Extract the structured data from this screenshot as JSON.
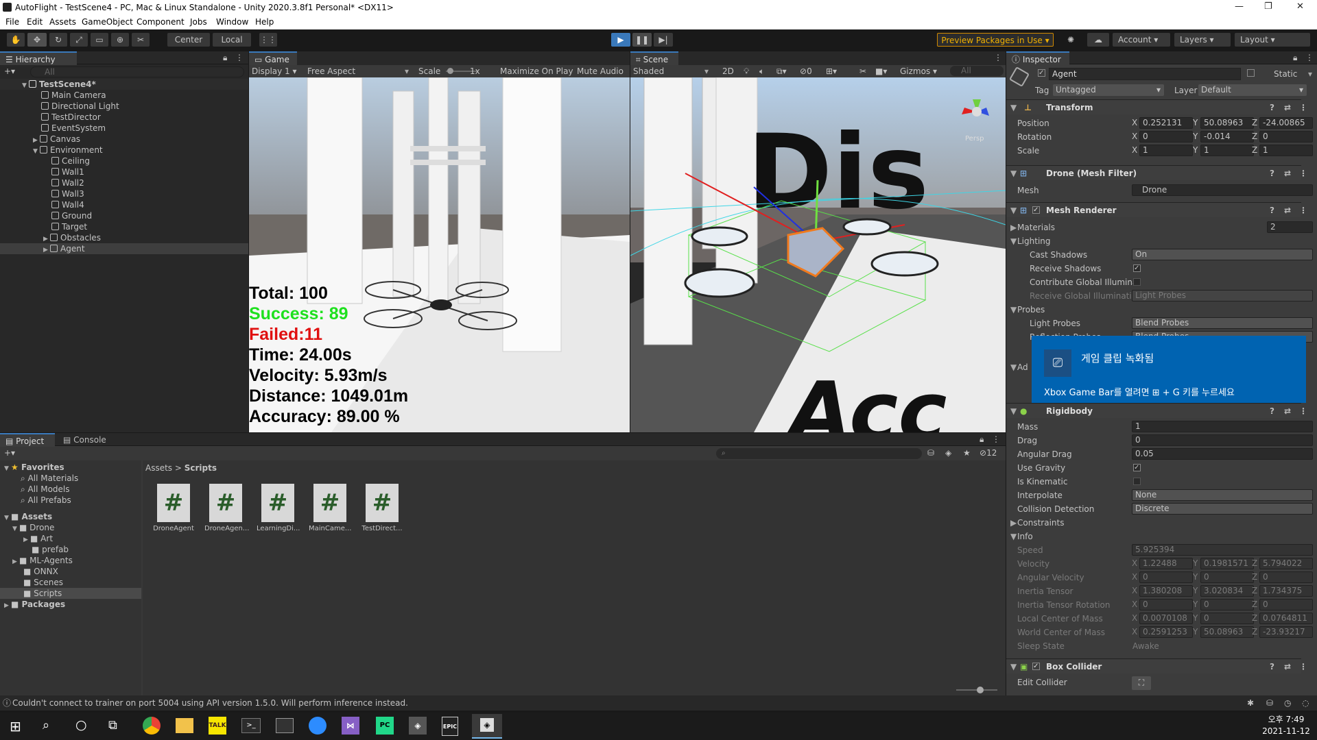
{
  "window": {
    "title": "AutoFlight - TestScene4 - PC, Mac & Linux Standalone - Unity 2020.3.8f1 Personal* <DX11>"
  },
  "menu": [
    "File",
    "Edit",
    "Assets",
    "GameObject",
    "Component",
    "Jobs",
    "Window",
    "Help"
  ],
  "toolbar": {
    "center": "Center",
    "local": "Local",
    "preview": "Preview Packages in Use",
    "account": "Account",
    "layers": "Layers",
    "layout": "Layout"
  },
  "hierarchy": {
    "tab": "Hierarchy",
    "search_placeholder": "All",
    "scene": "TestScene4*",
    "items": [
      "Main Camera",
      "Directional Light",
      "TestDirector",
      "EventSystem",
      "Canvas",
      "Environment",
      "Ceiling",
      "Wall1",
      "Wall2",
      "Wall3",
      "Wall4",
      "Ground",
      "Target",
      "Obstacles",
      "Agent"
    ]
  },
  "game": {
    "tab": "Game",
    "display": "Display 1",
    "aspect": "Free Aspect",
    "scale_label": "Scale",
    "scale_value": "1x",
    "maximize": "Maximize On Play",
    "mute": "Mute Audio",
    "stats": {
      "total": "Total: 100",
      "success": "Success: 89",
      "failed": "Failed:11",
      "time": "Time: 24.00s",
      "velocity": "Velocity: 5.93m/s",
      "distance": "Distance: 1049.01m",
      "accuracy": "Accuracy: 89.00 %"
    }
  },
  "scene": {
    "tab": "Scene",
    "shaded": "Shaded",
    "mode2d": "2D",
    "gizmos": "Gizmos",
    "search_placeholder": "All",
    "hidden_count": "0",
    "persp": "Persp"
  },
  "inspector": {
    "tab": "Inspector",
    "name": "Agent",
    "static": "Static",
    "tag_label": "Tag",
    "tag": "Untagged",
    "layer_label": "Layer",
    "layer": "Default",
    "transform": {
      "title": "Transform",
      "position": [
        "0.252131",
        "50.08963",
        "-24.00865"
      ],
      "rotation": [
        "0",
        "-0.014",
        "0"
      ],
      "scale": [
        "1",
        "1",
        "1"
      ],
      "labels": [
        "Position",
        "Rotation",
        "Scale"
      ]
    },
    "meshfilter": {
      "title": "Drone (Mesh Filter)",
      "mesh_label": "Mesh",
      "mesh": "Drone"
    },
    "meshrenderer": {
      "title": "Mesh Renderer",
      "materials": "Materials",
      "materials_count": "2",
      "lighting": "Lighting",
      "cast_shadows": "Cast Shadows",
      "cast_value": "On",
      "receive_shadows": "Receive Shadows",
      "contribute_gi": "Contribute Global Illuminat",
      "receive_gi": "Receive Global Illuminatior",
      "receive_gi_value": "Light Probes",
      "probes": "Probes",
      "light_probes": "Light Probes",
      "light_probes_value": "Blend Probes",
      "reflection_probes": "Reflection Probes",
      "reflection_value": "Blend Probes",
      "additional": "Ad"
    },
    "rigidbody": {
      "title": "Rigidbody",
      "mass": "Mass",
      "mass_v": "1",
      "drag": "Drag",
      "drag_v": "0",
      "angdrag": "Angular Drag",
      "angdrag_v": "0.05",
      "gravity": "Use Gravity",
      "kinematic": "Is Kinematic",
      "interp": "Interpolate",
      "interp_v": "None",
      "coll": "Collision Detection",
      "coll_v": "Discrete",
      "constraints": "Constraints",
      "info": "Info",
      "speed": "Speed",
      "speed_v": "5.925394",
      "velocity": "Velocity",
      "velocity_v": [
        "1.22488",
        "0.1981571",
        "5.794022"
      ],
      "angvel": "Angular Velocity",
      "angvel_v": [
        "0",
        "0",
        "0"
      ],
      "inertia": "Inertia Tensor",
      "inertia_v": [
        "1.380208",
        "3.020834",
        "1.734375"
      ],
      "inertiarot": "Inertia Tensor Rotation",
      "inertiarot_v": [
        "0",
        "0",
        "0"
      ],
      "localcom": "Local Center of Mass",
      "localcom_v": [
        "0.0070108",
        "0",
        "0.0764811"
      ],
      "worldcom": "World Center of Mass",
      "worldcom_v": [
        "0.2591253",
        "50.08963",
        "-23.93217"
      ],
      "sleep": "Sleep State",
      "sleep_v": "Awake"
    },
    "boxcollider": {
      "title": "Box Collider",
      "edit": "Edit Collider"
    }
  },
  "toast": {
    "title": "게임 클립 녹화됨",
    "msg_pre": "Xbox Game Bar를 열려면 ",
    "msg_post": " + G 키를 누르세요"
  },
  "project": {
    "tab": "Project",
    "console_tab": "Console",
    "favorites": "Favorites",
    "fav_items": [
      "All Materials",
      "All Models",
      "All Prefabs"
    ],
    "assets": "Assets",
    "tree": [
      "Drone",
      "Art",
      "prefab",
      "ML-Agents",
      "ONNX",
      "Scenes",
      "Scripts"
    ],
    "packages": "Packages",
    "breadcrumb": [
      "Assets",
      "Scripts"
    ],
    "hidden": "12",
    "files": [
      "DroneAgent",
      "DroneAgen...",
      "LearningDi...",
      "MainCame...",
      "TestDirect..."
    ]
  },
  "status": {
    "message": "Couldn't connect to trainer on port 5004 using API version 1.5.0. Will perform inference instead."
  },
  "clock": {
    "time": "오후 7:49",
    "date": "2021-11-12"
  }
}
